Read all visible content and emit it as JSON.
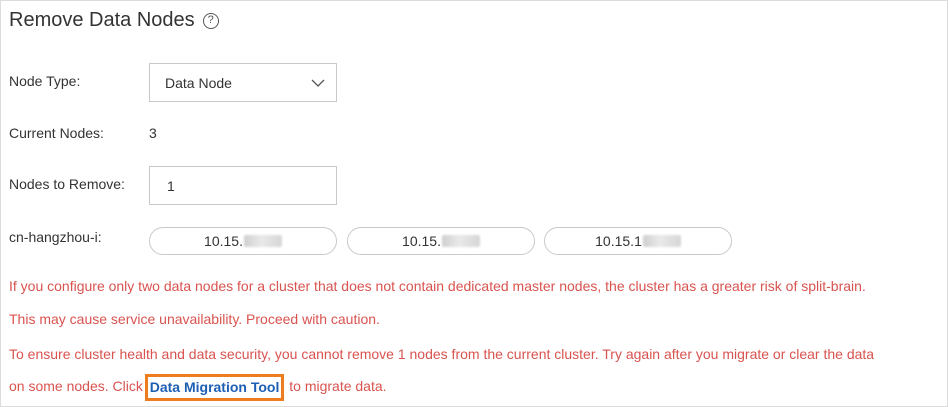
{
  "header": {
    "title": "Remove Data Nodes",
    "help_icon": "question-circle-icon",
    "help_glyph": "?"
  },
  "form": {
    "node_type_label": "Node Type:",
    "node_type_value": "Data Node",
    "current_nodes_label": "Current Nodes:",
    "current_nodes_value": "3",
    "nodes_to_remove_label": "Nodes to Remove:",
    "nodes_to_remove_value": "1",
    "zone_label": "cn-hangzhou-i:",
    "nodes": [
      {
        "ip_prefix": "10.15."
      },
      {
        "ip_prefix": "10.15."
      },
      {
        "ip_prefix": "10.15.1"
      }
    ]
  },
  "messages": {
    "warning_line1": "If you configure only two data nodes for a cluster that does not contain dedicated master nodes, the cluster has a greater risk of split-brain.",
    "warning_line2": "This may cause service unavailability. Proceed with caution.",
    "error_line1": "To ensure cluster health and data security, you cannot remove 1 nodes from the current cluster. Try again after you migrate or clear the data",
    "error_line2_prefix": "on some nodes. Click ",
    "link_label": "Data Migration Tool",
    "error_line2_suffix": " to migrate data."
  },
  "colors": {
    "warning_text": "#d9534f",
    "link": "#1d5fb3",
    "highlight_box": "#ee7d1f"
  }
}
